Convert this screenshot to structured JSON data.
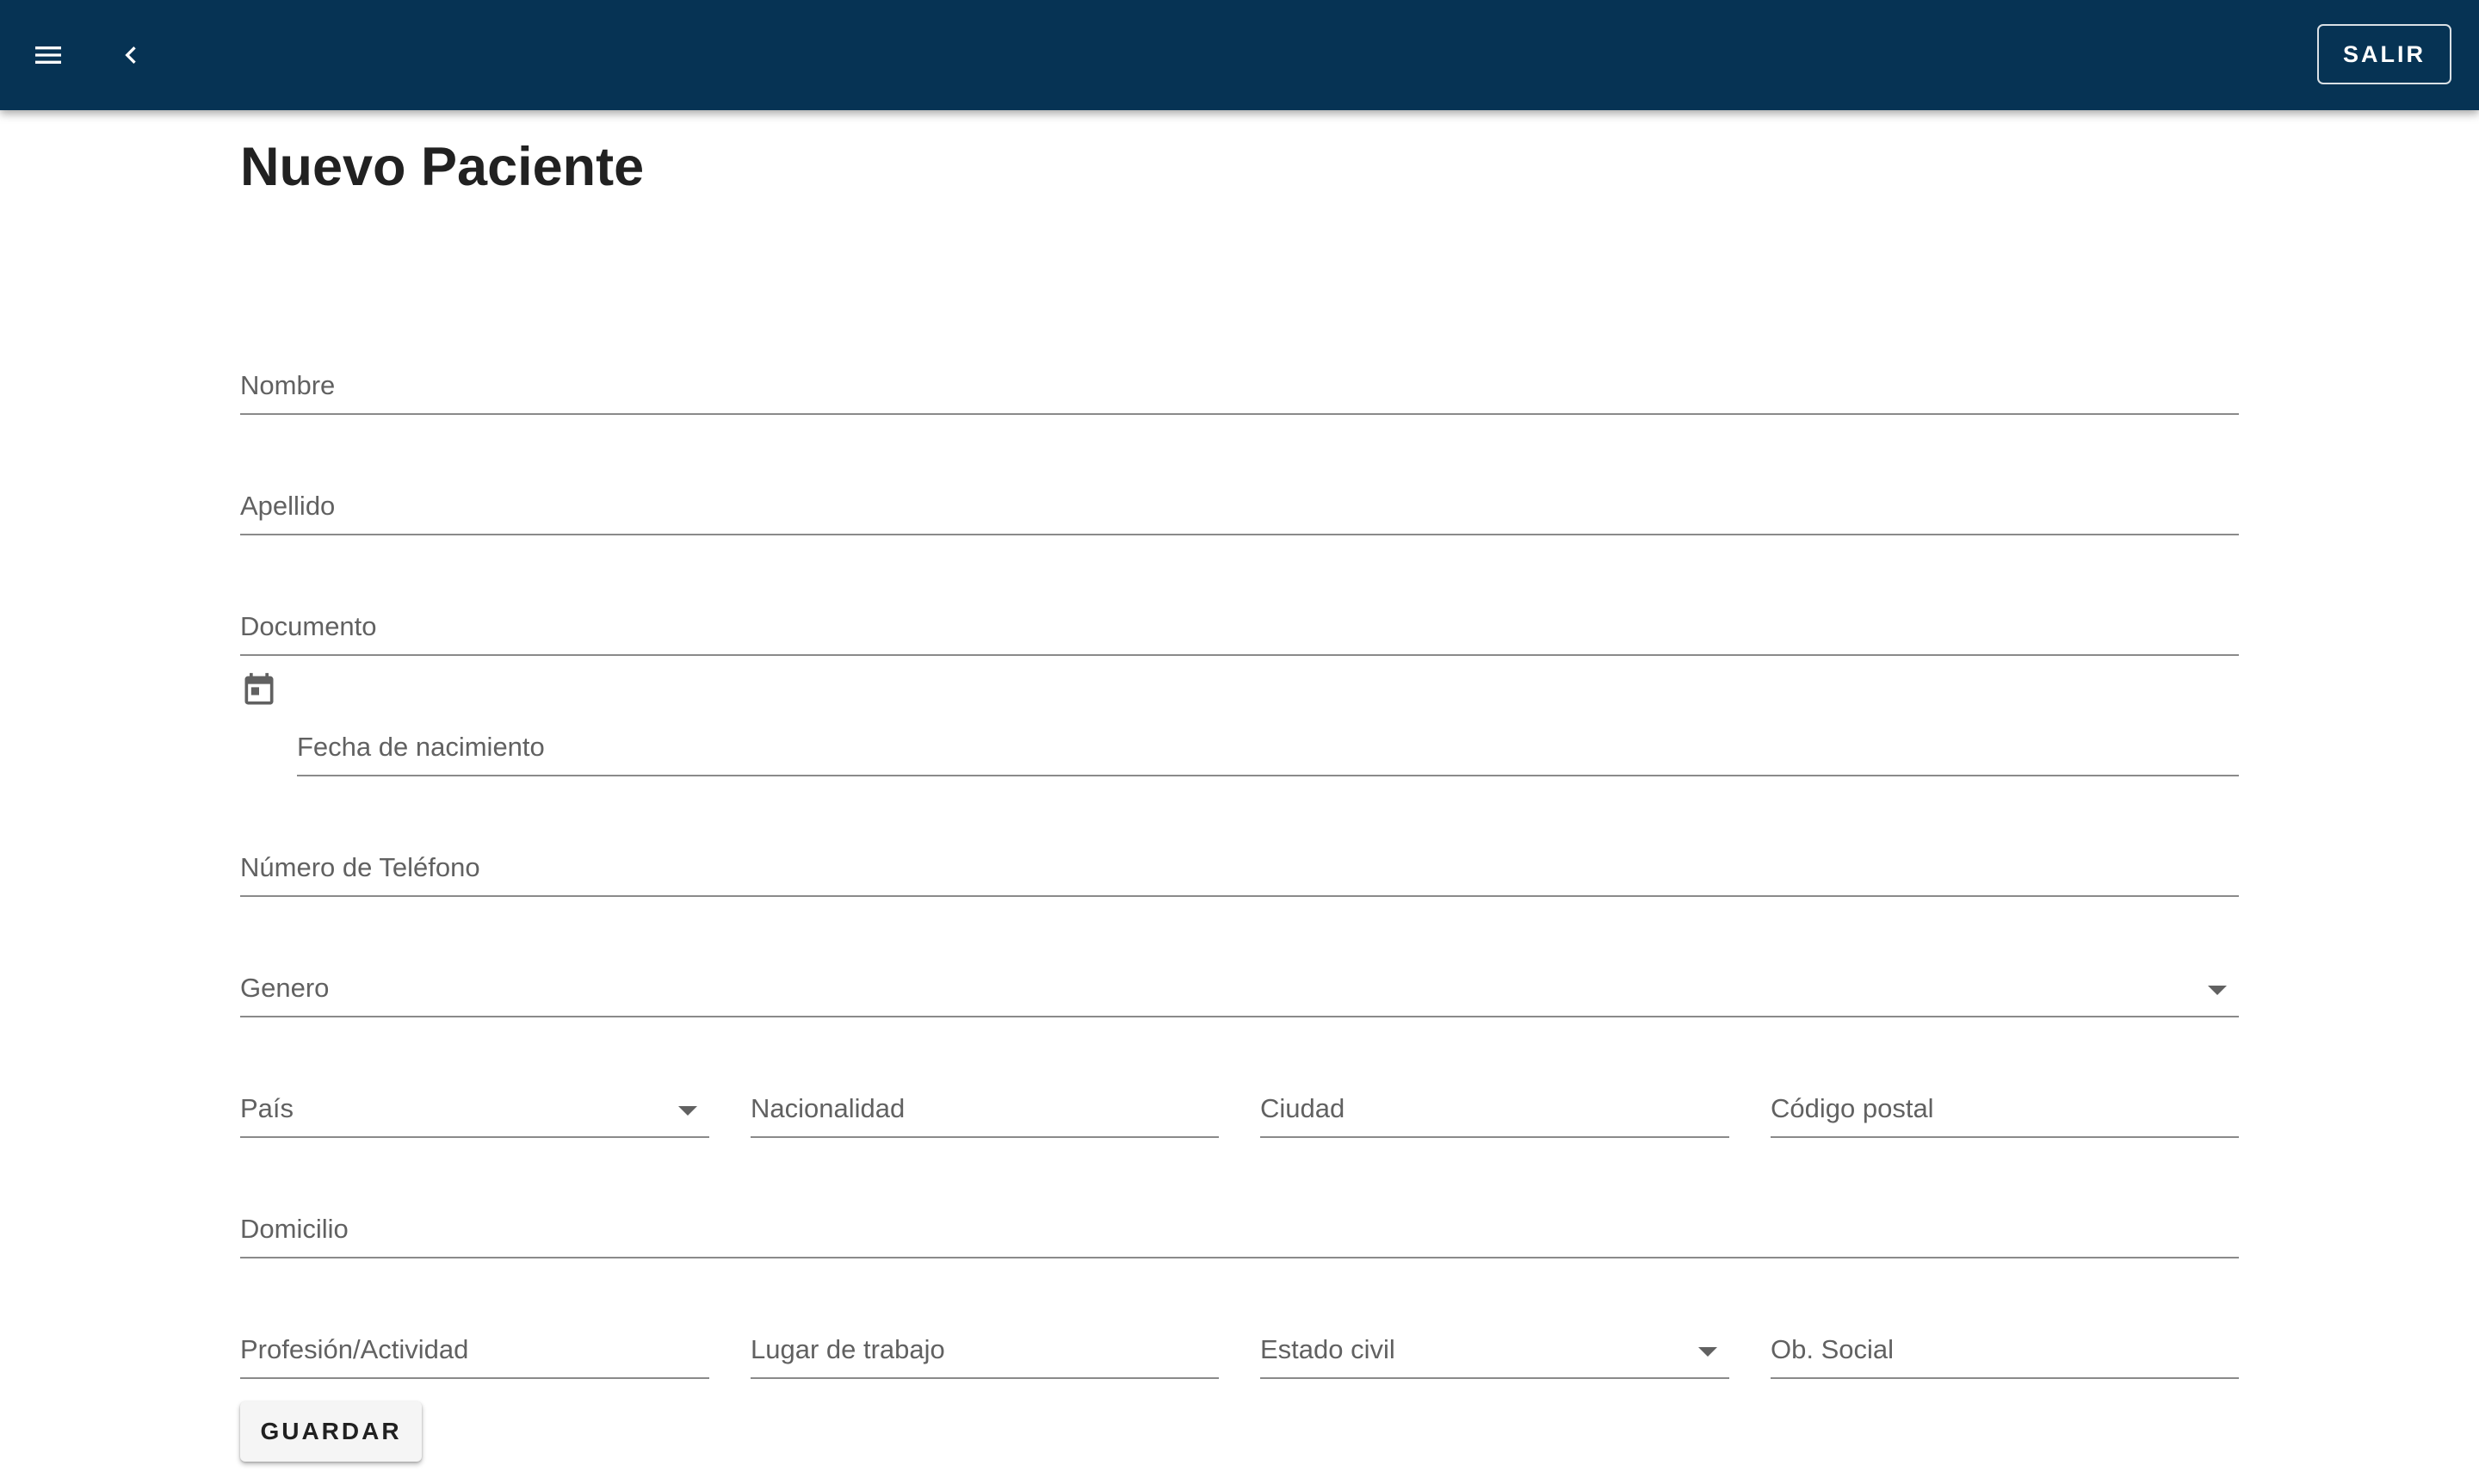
{
  "header": {
    "menu_icon": "menu-icon",
    "back_icon": "chevron-left-icon",
    "exit_label": "SALIR",
    "bar_color": "#063354"
  },
  "form": {
    "title": "Nuevo Paciente",
    "fields": {
      "nombre": "Nombre",
      "apellido": "Apellido",
      "documento": "Documento",
      "fecha_nacimiento": "Fecha de nacimiento",
      "telefono": "Número de Teléfono",
      "genero": "Genero",
      "pais": "País",
      "nacionalidad": "Nacionalidad",
      "ciudad": "Ciudad",
      "codigo_postal": "Código postal",
      "domicilio": "Domicilio",
      "profesion": "Profesión/Actividad",
      "lugar_trabajo": "Lugar de trabajo",
      "estado_civil": "Estado civil",
      "obra_social": "Ob. Social"
    },
    "date_icon": "calendar-icon",
    "save_label": "GUARDAR"
  }
}
